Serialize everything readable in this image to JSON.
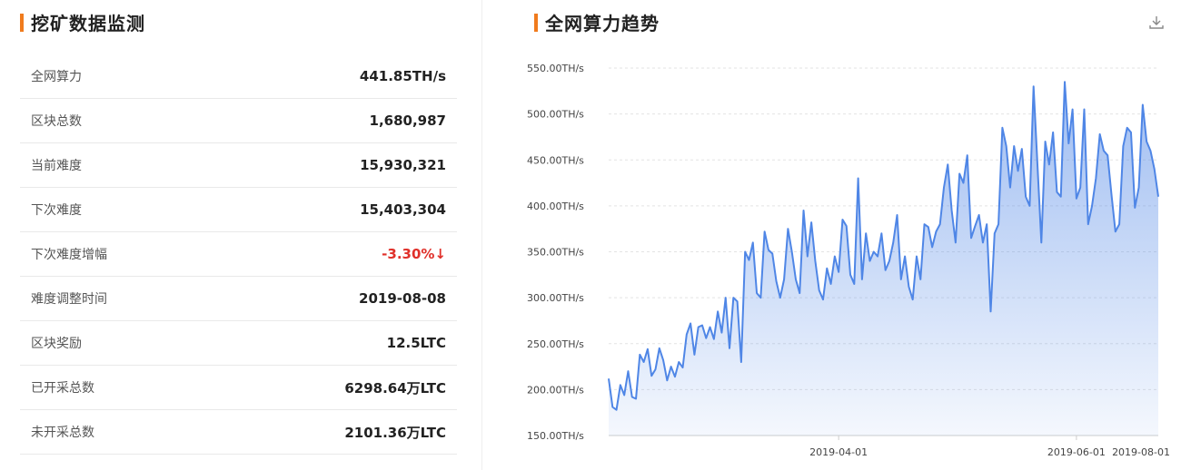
{
  "left": {
    "title": "挖矿数据监测",
    "rows": [
      {
        "label": "全网算力",
        "value": "441.85TH/s"
      },
      {
        "label": "区块总数",
        "value": "1,680,987"
      },
      {
        "label": "当前难度",
        "value": "15,930,321"
      },
      {
        "label": "下次难度",
        "value": "15,403,304"
      },
      {
        "label": "下次难度增幅",
        "value": "-3.30%↓"
      },
      {
        "label": "难度调整时间",
        "value": "2019-08-08"
      },
      {
        "label": "区块奖励",
        "value": "12.5LTC"
      },
      {
        "label": "已开采总数",
        "value": "6298.64万LTC"
      },
      {
        "label": "未开采总数",
        "value": "2101.36万LTC"
      }
    ]
  },
  "right": {
    "title": "全网算力趋势",
    "download_icon": "download-icon"
  },
  "colors": {
    "accent": "#f07b1d",
    "line": "#4f86e6",
    "negative": "#e0302a"
  },
  "chart_data": {
    "type": "area",
    "ytick_labels": [
      "550.00TH/s",
      "500.00TH/s",
      "450.00TH/s",
      "400.00TH/s",
      "350.00TH/s",
      "300.00TH/s",
      "250.00TH/s",
      "200.00TH/s",
      "150.00TH/s"
    ],
    "xtick_labels": [
      "2019-04-01",
      "2019-06-01",
      "2019-08-01"
    ],
    "xticks_day": [
      59,
      120,
      181
    ],
    "ylim": [
      150,
      550
    ],
    "grid": true,
    "x_start": "2019-01-01",
    "series": [
      {
        "name": "",
        "values": [
          212,
          181,
          178,
          205,
          194,
          220,
          192,
          190,
          238,
          230,
          244,
          215,
          222,
          245,
          232,
          210,
          225,
          214,
          230,
          224,
          260,
          272,
          238,
          268,
          270,
          256,
          268,
          255,
          285,
          262,
          300,
          245,
          300,
          296,
          230,
          350,
          341,
          360,
          305,
          300,
          372,
          352,
          348,
          318,
          300,
          320,
          375,
          350,
          320,
          305,
          395,
          345,
          382,
          340,
          308,
          298,
          332,
          315,
          345,
          328,
          385,
          378,
          325,
          315,
          430,
          320,
          370,
          340,
          350,
          345,
          370,
          330,
          340,
          360,
          390,
          320,
          345,
          312,
          298,
          345,
          320,
          380,
          377,
          355,
          372,
          380,
          420,
          445,
          395,
          360,
          435,
          425,
          455,
          365,
          378,
          390,
          360,
          380,
          285,
          370,
          380,
          485,
          465,
          420,
          465,
          438,
          462,
          410,
          400,
          530,
          445,
          360,
          470,
          445,
          480,
          415,
          410,
          535,
          468,
          505,
          408,
          420,
          505,
          380,
          400,
          430,
          478,
          460,
          455,
          412,
          372,
          380,
          465,
          485,
          480,
          398,
          420,
          510,
          470,
          460,
          440,
          410
        ]
      }
    ]
  }
}
